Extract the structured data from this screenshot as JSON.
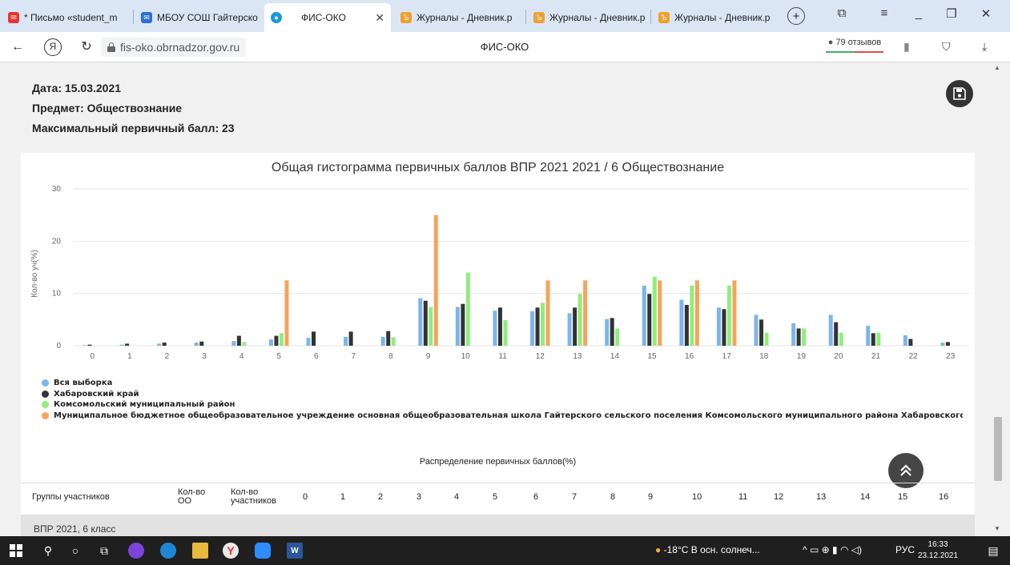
{
  "browser": {
    "tabs": [
      {
        "label": "* Письмо «student_m",
        "icon": "mail-icon"
      },
      {
        "label": "МБОУ СОШ Гайтерско",
        "icon": "envelope-icon"
      },
      {
        "label": "ФИС-ОКО",
        "icon": "fis-icon",
        "active": true
      },
      {
        "label": "Журналы - Дневник.р",
        "icon": "dnevnik-icon"
      },
      {
        "label": "Журналы - Дневник.р",
        "icon": "dnevnik-icon"
      },
      {
        "label": "Журналы - Дневник.р",
        "icon": "dnevnik-icon"
      }
    ],
    "url": "fis-oko.obrnadzor.gov.ru",
    "page_title": "ФИС-ОКО",
    "reviews": "79 отзывов"
  },
  "info": {
    "date": "Дата: 15.03.2021",
    "subject": "Предмет: Обществознание",
    "max_score": "Максимальный первичный балл: 23"
  },
  "chart_data": {
    "type": "bar",
    "title": "Общая гистограмма первичных баллов ВПР 2021 2021 / 6 Обществознание",
    "xlabel": "",
    "ylabel": "Кол-во уч(%)",
    "ylim": [
      0,
      30
    ],
    "yticks": [
      0,
      10,
      20,
      30
    ],
    "grid": true,
    "legend_position": "bottom-left",
    "categories": [
      "0",
      "1",
      "2",
      "3",
      "4",
      "5",
      "6",
      "7",
      "8",
      "9",
      "10",
      "11",
      "12",
      "13",
      "14",
      "15",
      "16",
      "17",
      "18",
      "19",
      "20",
      "21",
      "22",
      "23"
    ],
    "series": [
      {
        "name": "Вся выборка",
        "color": "#7cb5ec",
        "values": [
          0.1,
          0.2,
          0.4,
          0.6,
          0.9,
          1.2,
          1.5,
          1.7,
          1.7,
          9.1,
          7.4,
          6.7,
          6.6,
          6.2,
          5.1,
          11.5,
          8.8,
          7.3,
          5.9,
          4.3,
          5.9,
          3.8,
          2.0,
          0.6
        ]
      },
      {
        "name": "Хабаровский край",
        "color": "#333333",
        "values": [
          0.2,
          0.4,
          0.6,
          0.8,
          1.9,
          1.9,
          2.7,
          2.7,
          2.8,
          8.6,
          8.0,
          7.3,
          7.3,
          7.3,
          5.3,
          9.9,
          7.8,
          7.0,
          5.0,
          3.3,
          4.5,
          2.4,
          1.3,
          0.7
        ]
      },
      {
        "name": "Комсомольский муниципальный район",
        "color": "#90ed7d",
        "values": [
          0,
          0,
          0,
          0,
          0.7,
          2.4,
          0,
          0,
          1.6,
          7.4,
          14.0,
          4.9,
          8.2,
          9.9,
          3.3,
          13.2,
          11.5,
          11.5,
          2.5,
          3.3,
          2.5,
          2.5,
          0,
          0
        ]
      },
      {
        "name": "Муниципальное бюджетное общеобразовательное учреждение основная общеобразовательная школа Гайтерского сельского поселения Комсомольского муниципального района Хабаровского кр...",
        "color": "#f7a35c",
        "values": [
          0,
          0,
          0,
          0,
          0,
          12.5,
          0,
          0,
          0,
          25.0,
          0,
          0,
          12.5,
          12.5,
          0,
          12.5,
          12.5,
          12.5,
          0,
          0,
          0,
          0,
          0,
          0
        ]
      }
    ]
  },
  "distribution": {
    "title": "Распределение первичных баллов(%)",
    "headers": [
      "Группы участников",
      "Кол-во ОО",
      "Кол-во участников",
      "0",
      "1",
      "2",
      "3",
      "4",
      "5",
      "6",
      "7",
      "8",
      "9",
      "10",
      "11",
      "12",
      "13",
      "14",
      "15",
      "16"
    ],
    "first_row": "ВПР 2021, 6 класс"
  },
  "taskbar": {
    "weather": "-18°C  В осн. солнеч...",
    "lang": "РУС",
    "time": "16:33",
    "date": "23.12.2021"
  }
}
